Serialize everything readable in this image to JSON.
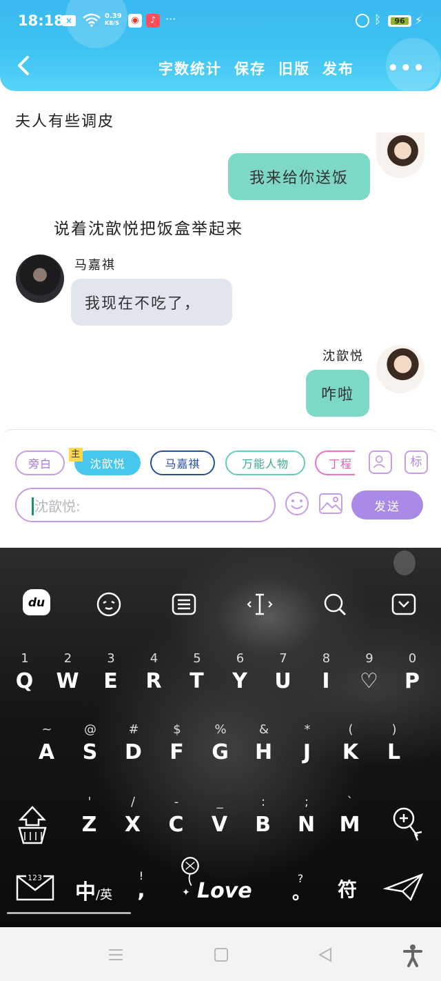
{
  "status_bar": {
    "time": "18:18",
    "net_speed_value": "0.39",
    "net_speed_unit": "KB/S",
    "more": "···",
    "battery": "96"
  },
  "header": {
    "actions": [
      "字数统计",
      "保存",
      "旧版",
      "发布"
    ],
    "menu": "•••"
  },
  "chat": {
    "narration_1": "夫人有些调皮",
    "message_right_1": "我来给你送饭",
    "narration_2": "说着沈歆悦把饭盒举起来",
    "sender_left": "马嘉祺",
    "message_left": "我现在不吃了，",
    "sender_right": "沈歆悦",
    "message_right_2": "咋啦"
  },
  "composer": {
    "chips": {
      "narration": "旁白",
      "main": "沈歆悦",
      "main_tag": "主",
      "ma": "马嘉祺",
      "wan": "万能人物",
      "ding": "丁程"
    },
    "tag_label": "标",
    "input_placeholder": "沈歆悦:",
    "send_label": "发送"
  },
  "keyboard": {
    "row1": [
      {
        "hint": "1",
        "key": "Q"
      },
      {
        "hint": "2",
        "key": "W"
      },
      {
        "hint": "3",
        "key": "E"
      },
      {
        "hint": "4",
        "key": "R"
      },
      {
        "hint": "5",
        "key": "T"
      },
      {
        "hint": "6",
        "key": "Y"
      },
      {
        "hint": "7",
        "key": "U"
      },
      {
        "hint": "8",
        "key": "I"
      },
      {
        "hint": "9",
        "key": "♡"
      },
      {
        "hint": "0",
        "key": "P"
      }
    ],
    "row2": [
      {
        "hint": "~",
        "key": "A"
      },
      {
        "hint": "@",
        "key": "S"
      },
      {
        "hint": "#",
        "key": "D"
      },
      {
        "hint": "$",
        "key": "F"
      },
      {
        "hint": "%",
        "key": "G"
      },
      {
        "hint": "&",
        "key": "H"
      },
      {
        "hint": "*",
        "key": "J"
      },
      {
        "hint": "(",
        "key": "K"
      },
      {
        "hint": ")",
        "key": "L"
      }
    ],
    "row3": [
      {
        "hint": "'",
        "key": "Z"
      },
      {
        "hint": "/",
        "key": "X"
      },
      {
        "hint": "-",
        "key": "C"
      },
      {
        "hint": "_",
        "key": "V"
      },
      {
        "hint": ":",
        "key": "B"
      },
      {
        "hint": ";",
        "key": "N"
      },
      {
        "hint": "`",
        "key": "M"
      }
    ],
    "lang_main": "中",
    "lang_alt": "/英",
    "comma_hint": "!",
    "comma": ",",
    "space_label": "Love",
    "period_hint": "?",
    "period": "。",
    "symbols": "符",
    "numbers_badge": "123"
  }
}
